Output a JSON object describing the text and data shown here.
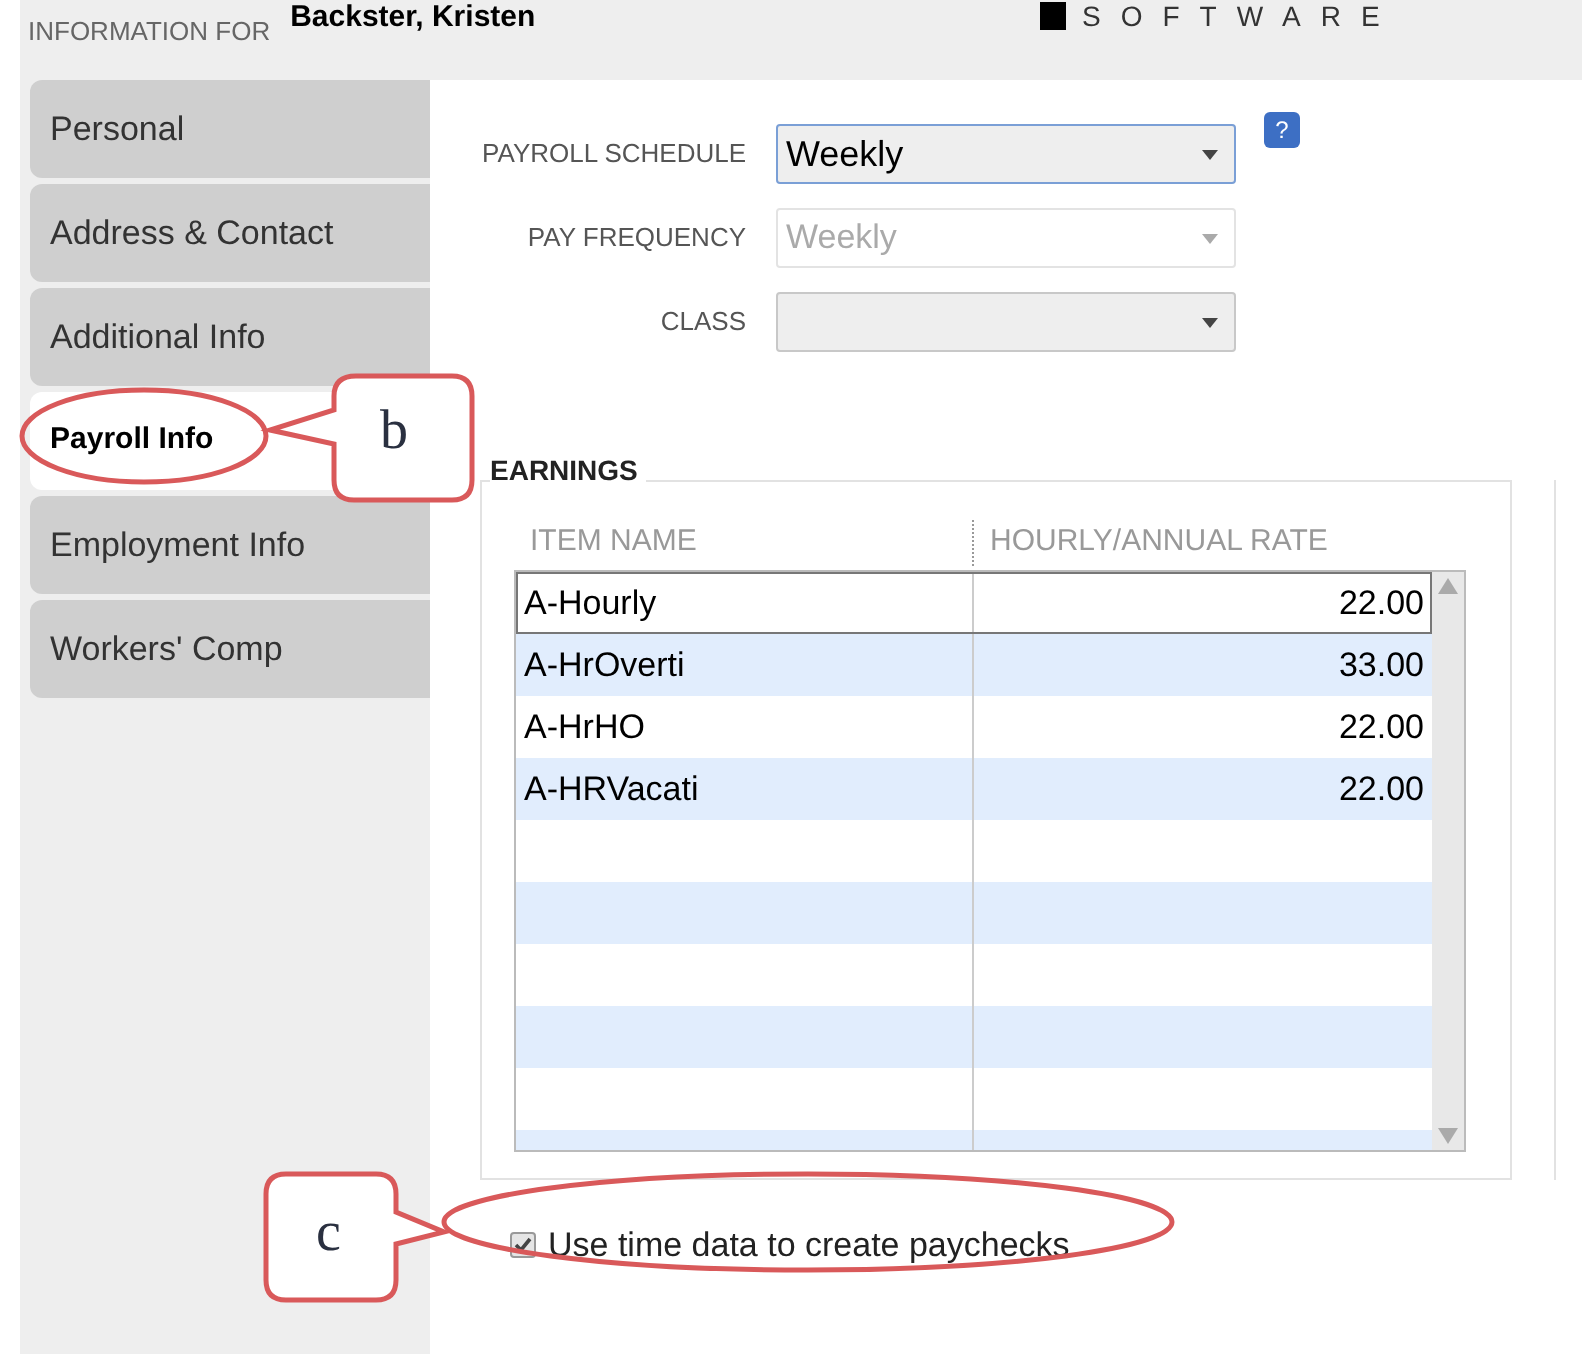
{
  "header": {
    "label": "INFORMATION FOR",
    "name": "Backster, Kristen",
    "logo_text": "SOFTWARE"
  },
  "sidebar": {
    "tabs": [
      {
        "label": "Personal",
        "selected": false
      },
      {
        "label": "Address & Contact",
        "selected": false
      },
      {
        "label": "Additional Info",
        "selected": false
      },
      {
        "label": "Payroll Info",
        "selected": true
      },
      {
        "label": "Employment Info",
        "selected": false
      },
      {
        "label": "Workers' Comp",
        "selected": false
      }
    ]
  },
  "form": {
    "fields": [
      {
        "label": "PAYROLL SCHEDULE",
        "value": "Weekly",
        "disabled": false,
        "help": "?"
      },
      {
        "label": "PAY FREQUENCY",
        "value": "Weekly",
        "disabled": true
      },
      {
        "label": "CLASS",
        "disabled": false
      }
    ]
  },
  "earnings": {
    "title": "EARNINGS",
    "columns": [
      "ITEM NAME",
      "HOURLY/ANNUAL RATE"
    ],
    "rows": [
      {
        "item": "A-Hourly",
        "rate": "22.00",
        "selected": true
      },
      {
        "item": "A-HrOverti",
        "rate": "33.00",
        "selected": false
      },
      {
        "item": "A-HrHO",
        "rate": "22.00",
        "selected": false
      },
      {
        "item": "A-HRVacati",
        "rate": "22.00",
        "selected": false
      }
    ]
  },
  "use_time_data": {
    "label": "Use time data to create paychecks",
    "checked": true
  },
  "callouts": [
    {
      "label": "b"
    },
    {
      "label": "c"
    }
  ]
}
